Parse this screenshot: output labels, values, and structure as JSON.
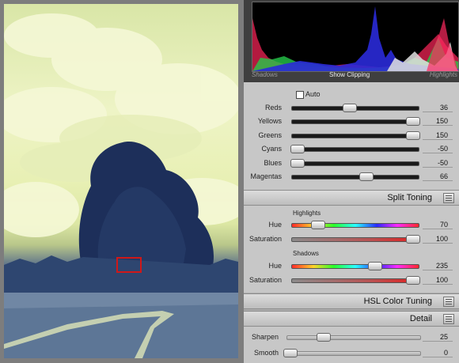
{
  "histogram": {
    "shadows_label": "Shadows",
    "clipping_label": "Show Clipping",
    "highlights_label": "Highlights"
  },
  "grayscale_mix": {
    "auto_label": "Auto",
    "sliders": [
      {
        "label": "Reds",
        "value": "36",
        "fraction": 0.45
      },
      {
        "label": "Yellows",
        "value": "150",
        "fraction": 0.95
      },
      {
        "label": "Greens",
        "value": "150",
        "fraction": 0.95
      },
      {
        "label": "Cyans",
        "value": "-50",
        "fraction": 0.04
      },
      {
        "label": "Blues",
        "value": "-50",
        "fraction": 0.04
      },
      {
        "label": "Magentas",
        "value": "66",
        "fraction": 0.58
      }
    ]
  },
  "split_toning": {
    "title": "Split Toning",
    "highlights_label": "Highlights",
    "highlights_hue": {
      "label": "Hue",
      "value": "70",
      "fraction": 0.2
    },
    "highlights_saturation": {
      "label": "Saturation",
      "value": "100",
      "fraction": 0.95
    },
    "shadows_label": "Shadows",
    "shadows_hue": {
      "label": "Hue",
      "value": "235",
      "fraction": 0.65
    },
    "shadows_saturation": {
      "label": "Saturation",
      "value": "100",
      "fraction": 0.95
    }
  },
  "hsl": {
    "title": "HSL Color Tuning"
  },
  "detail": {
    "title": "Detail",
    "sharpen": {
      "label": "Sharpen",
      "value": "25",
      "fraction": 0.27
    },
    "smooth": {
      "label": "Smooth",
      "value": "0",
      "fraction": 0.02
    }
  }
}
